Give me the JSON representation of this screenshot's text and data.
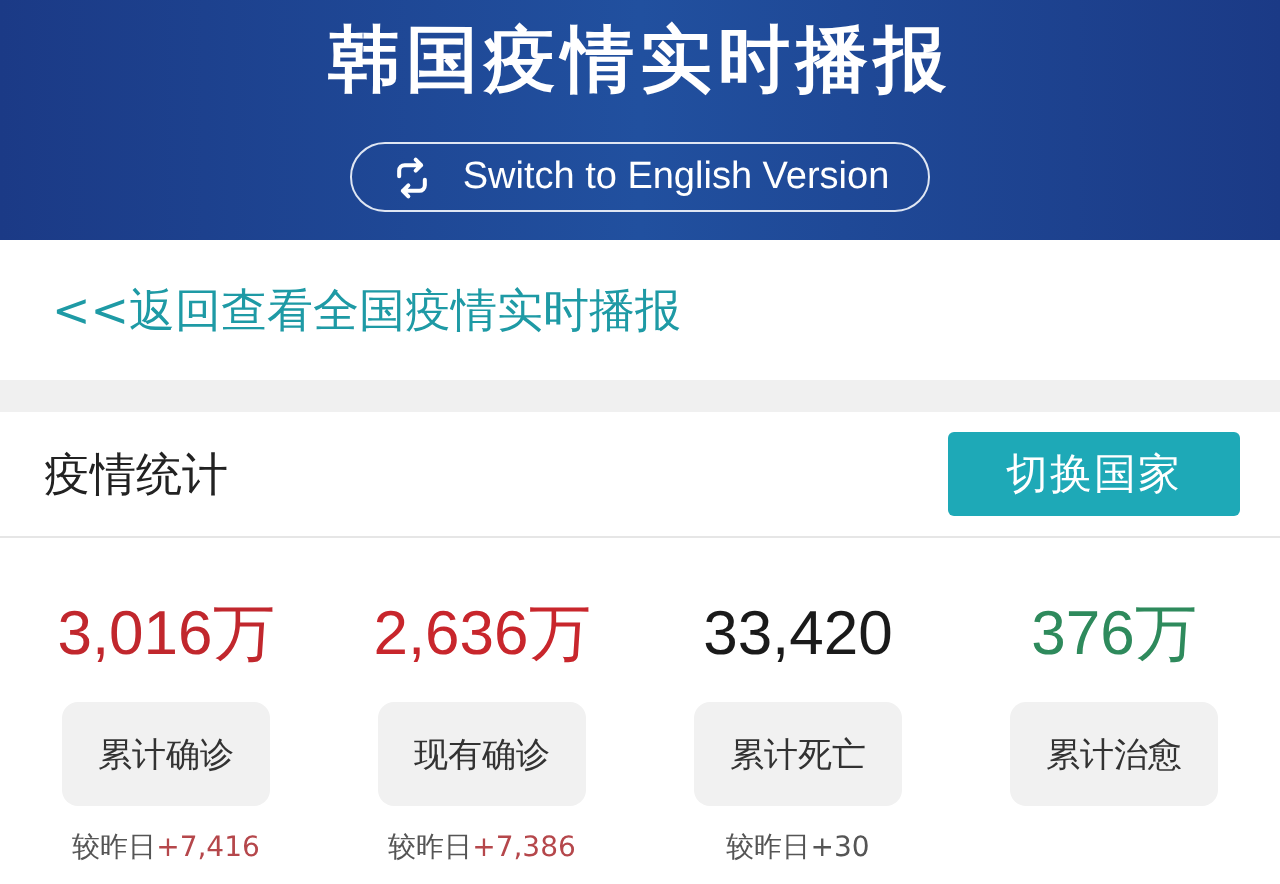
{
  "header": {
    "title": "韩国疫情实时播报",
    "switch_button": "Switch to English Version"
  },
  "back_link": "<<返回查看全国疫情实时播报",
  "stats_card": {
    "title": "疫情统计",
    "switch_country_button": "切换国家",
    "stats": [
      {
        "value": "3,016万",
        "color": "#c1272d",
        "label": "累计确诊",
        "delta_prefix": "较昨日",
        "delta": {
          "text": "+7,416",
          "color": "#b5474b"
        }
      },
      {
        "value": "2,636万",
        "color": "#c8262c",
        "label": "现有确诊",
        "delta_prefix": "较昨日",
        "delta": {
          "text": "+7,386",
          "color": "#b5474b"
        }
      },
      {
        "value": "33,420",
        "color": "#1a1a1a",
        "label": "累计死亡",
        "delta_prefix": "较昨日",
        "delta": {
          "text": "+30",
          "color": "#555555"
        }
      },
      {
        "value": "376万",
        "color": "#2e8a5c",
        "label": "累计治愈"
      }
    ]
  }
}
